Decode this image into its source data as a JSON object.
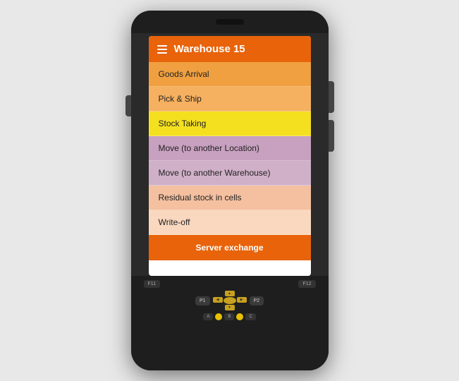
{
  "header": {
    "title": "Warehouse 15",
    "menu_icon": "hamburger"
  },
  "menu_items": [
    {
      "id": "goods-arrival",
      "label": "Goods Arrival",
      "class": "goods-arrival"
    },
    {
      "id": "pick-ship",
      "label": "Pick & Ship",
      "class": "pick-ship"
    },
    {
      "id": "stock-taking",
      "label": "Stock Taking",
      "class": "stock-taking"
    },
    {
      "id": "move-location",
      "label": "Move (to another Location)",
      "class": "move-location"
    },
    {
      "id": "move-warehouse",
      "label": "Move (to another Warehouse)",
      "class": "move-warehouse"
    },
    {
      "id": "residual",
      "label": "Residual stock in cells",
      "class": "residual"
    },
    {
      "id": "writeoff",
      "label": "Write-off",
      "class": "writeoff"
    }
  ],
  "server_exchange": {
    "label": "Server exchange"
  },
  "keypad": {
    "fn_keys": [
      "F11",
      "F12"
    ],
    "p_keys": [
      "P1",
      "P2"
    ],
    "alpha_keys": [
      "A",
      "B",
      "C"
    ],
    "dpad_arrows": [
      "▲",
      "◀",
      "▶",
      "▼"
    ]
  },
  "colors": {
    "header_bg": "#e8630a",
    "goods_arrival": "#f0a040",
    "pick_ship": "#f5b060",
    "stock_taking": "#f5e020",
    "move_location": "#c8a0c0",
    "move_warehouse": "#d0b0c8",
    "residual": "#f5c0a0",
    "writeoff": "#fad8c0"
  }
}
